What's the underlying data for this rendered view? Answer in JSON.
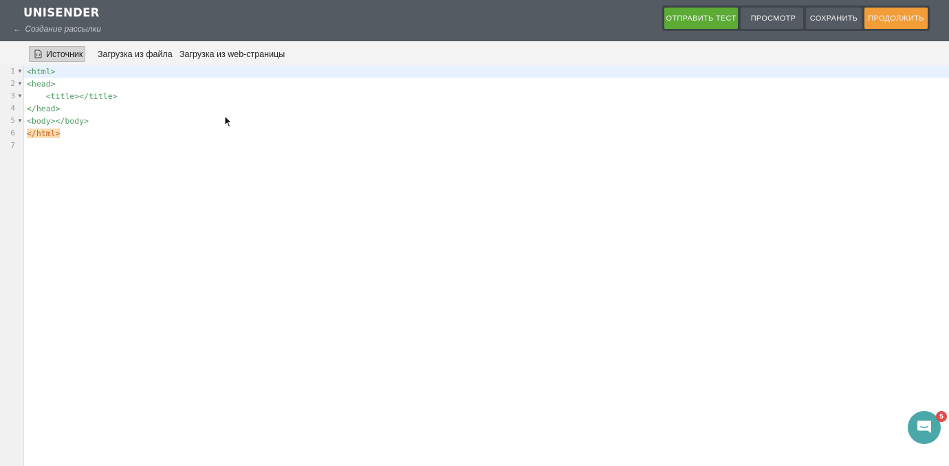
{
  "header": {
    "logo": "UNISENDER",
    "back_arrow": "←",
    "back_label": "Создание рассылки",
    "buttons": {
      "send_test": "ОТПРАВИТЬ ТЕСТ",
      "preview": "ПРОСМОТР",
      "save": "СОХРАНИТЬ",
      "continue": "ПРОДОЛЖИТЬ"
    }
  },
  "tabs": {
    "source": "Источник",
    "file_upload": "Загрузка из файла",
    "web_upload": "Загрузка из web-страницы"
  },
  "editor": {
    "line_numbers": [
      "1",
      "2",
      "3",
      "4",
      "5",
      "6",
      "7"
    ],
    "lines": [
      "<html>",
      "<head>",
      "    <title></title>",
      "</head>",
      "<body></body>",
      "</html>",
      ""
    ]
  },
  "chat": {
    "badge_count": "5"
  },
  "colors": {
    "header_bg": "#545b62",
    "send_green": "#5bab35",
    "continue_orange": "#f29d38",
    "code_green": "#4e9a63",
    "chat_teal": "#4ba8a8",
    "badge_red": "#e24c4c"
  }
}
